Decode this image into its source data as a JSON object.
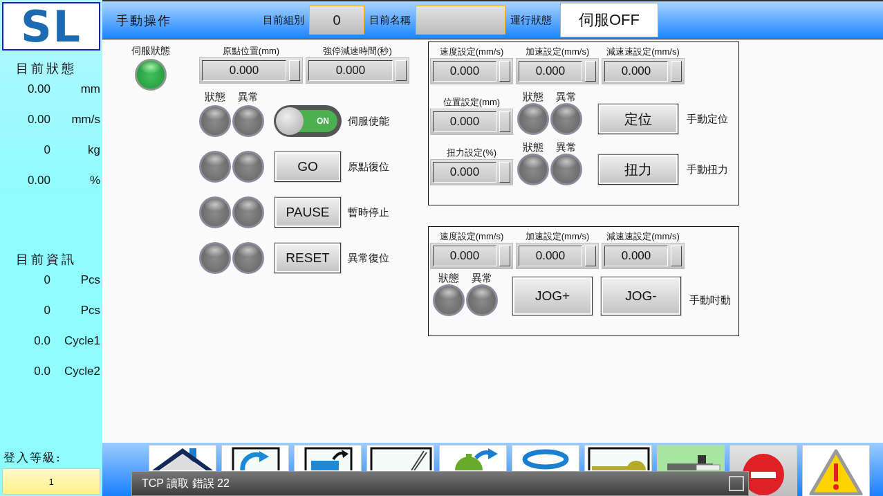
{
  "sidebar": {
    "logo": "SL",
    "status_title": "目前狀態",
    "status_rows": [
      {
        "value": "0.00",
        "unit": "mm"
      },
      {
        "value": "0.00",
        "unit": "mm/s"
      },
      {
        "value": "0",
        "unit": "kg"
      },
      {
        "value": "0.00",
        "unit": "%"
      }
    ],
    "info_title": "目前資訊",
    "info_rows": [
      {
        "value": "0",
        "unit": "Pcs"
      },
      {
        "value": "0",
        "unit": "Pcs"
      },
      {
        "value": "0.0",
        "unit": "Cycle1"
      },
      {
        "value": "0.0",
        "unit": "Cycle2"
      }
    ],
    "login_label": "登入等級:",
    "login_level": "1"
  },
  "header": {
    "title": "手動操作",
    "group_label": "目前組別",
    "group_value": "0",
    "name_label": "目前名稱",
    "run_label": "運行狀態",
    "run_value": "伺服OFF"
  },
  "servo": {
    "label": "伺服狀態",
    "on": true
  },
  "home_fields": [
    {
      "label": "原點位置(mm)",
      "value": "0.000"
    },
    {
      "label": "強停減速時間(秒)",
      "value": "0.000"
    }
  ],
  "lamp_headers": [
    "狀態",
    "異常"
  ],
  "actions": [
    {
      "kind": "toggle",
      "control": "ON",
      "on": true,
      "lamps": [
        {
          "on": false
        },
        {
          "on": false
        }
      ],
      "label": "伺服使能"
    },
    {
      "kind": "button",
      "control": "GO",
      "lamps": [
        {
          "on": false
        },
        {
          "on": false
        }
      ],
      "label": "原點復位"
    },
    {
      "kind": "button",
      "control": "PAUSE",
      "lamps": [
        {
          "on": false
        },
        {
          "on": false
        }
      ],
      "label": "暫時停止"
    },
    {
      "kind": "button",
      "control": "RESET",
      "lamps": [
        {
          "on": false
        },
        {
          "on": false
        }
      ],
      "label": "異常復位"
    }
  ],
  "position_panel": {
    "fields": [
      {
        "label": "速度設定(mm/s)",
        "value": "0.000"
      },
      {
        "label": "加速設定(mm/s)",
        "value": "0.000"
      },
      {
        "label": "減速速設定(mm/s)",
        "value": "0.000"
      }
    ],
    "rows": [
      {
        "field_label": "位置設定(mm)",
        "value": "0.000",
        "lamp_headers": [
          "狀態",
          "異常"
        ],
        "lamps": [
          {
            "on": false
          },
          {
            "on": false
          }
        ],
        "button": "定位",
        "label": "手動定位"
      },
      {
        "field_label": "扭力設定(%)",
        "value": "0.000",
        "lamp_headers": [
          "狀態",
          "異常"
        ],
        "lamps": [
          {
            "on": false
          },
          {
            "on": false
          }
        ],
        "button": "扭力",
        "label": "手動扭力"
      }
    ]
  },
  "jog_panel": {
    "fields": [
      {
        "label": "速度設定(mm/s)",
        "value": "0.000"
      },
      {
        "label": "加速設定(mm/s)",
        "value": "0.000"
      },
      {
        "label": "減速速設定(mm/s)",
        "value": "0.000"
      }
    ],
    "lamp_headers": [
      "狀態",
      "異常"
    ],
    "lamps": [
      {
        "on": false
      },
      {
        "on": false
      }
    ],
    "buttons": [
      "JOG+",
      "JOG-"
    ],
    "label": "手動吋動"
  },
  "toolbar": [
    {
      "kind": "home"
    },
    {
      "kind": "refresh"
    },
    {
      "kind": "folder"
    },
    {
      "kind": "pen"
    },
    {
      "kind": "gear"
    },
    {
      "kind": "ring"
    },
    {
      "kind": "key"
    },
    {
      "kind": "machine"
    },
    {
      "kind": "stop"
    },
    {
      "kind": "warning"
    }
  ],
  "alert": {
    "message": "TCP 讀取 錯誤 22"
  }
}
